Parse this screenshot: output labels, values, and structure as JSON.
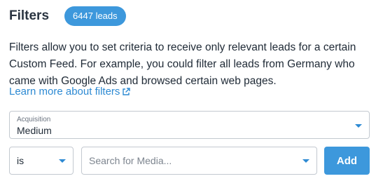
{
  "header": {
    "title": "Filters",
    "leads_badge": "6447 leads"
  },
  "description": {
    "text": "Filters allow you to set criteria to receive only relevant leads for a certain Custom Feed. For example, you could filter all leads from Germany who came with Google Ads and browsed certain web pages.",
    "learn_more_link": "Learn more about filters"
  },
  "filter": {
    "category_label": "Acquisition",
    "category_value": "Medium",
    "operator_value": "is",
    "search_placeholder": "Search for Media...",
    "add_button": "Add"
  },
  "colors": {
    "accent": "#3d98dc",
    "link": "#2d8ad3",
    "text": "#1f2a36"
  },
  "icons": {
    "external_link": "external-link-icon",
    "dropdown": "chevron-down-icon"
  }
}
